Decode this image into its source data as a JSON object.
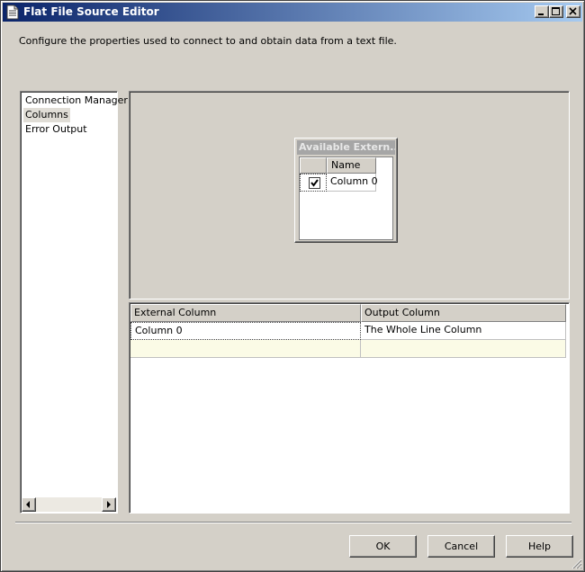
{
  "window": {
    "title": "Flat File Source Editor",
    "description": "Configure the properties used to connect to and obtain data from a text file."
  },
  "nav": {
    "items": [
      {
        "label": "Connection Manager",
        "selected": false
      },
      {
        "label": "Columns",
        "selected": true
      },
      {
        "label": "Error Output",
        "selected": false
      }
    ]
  },
  "available_columns": {
    "title": "Available Extern...",
    "name_header": "Name",
    "rows": [
      {
        "checked": true,
        "name": "Column 0"
      }
    ]
  },
  "mapping_grid": {
    "headers": [
      "External Column",
      "Output Column"
    ],
    "rows": [
      {
        "external": "Column 0",
        "output": "The Whole Line Column"
      }
    ]
  },
  "buttons": {
    "ok": "OK",
    "cancel": "Cancel",
    "help": "Help"
  },
  "colors": {
    "titlebar_start": "#0a246a",
    "titlebar_end": "#a6caf0",
    "face": "#d4d0c8",
    "new_row": "#fbfbe6"
  },
  "icons": {
    "app": "flat-file-icon",
    "minimize": "minimize-icon",
    "maximize": "maximize-icon",
    "close": "close-icon",
    "checkmark": "checkmark-icon",
    "scroll_left": "arrow-left-icon",
    "scroll_right": "arrow-right-icon",
    "resize": "resize-grip-icon"
  }
}
